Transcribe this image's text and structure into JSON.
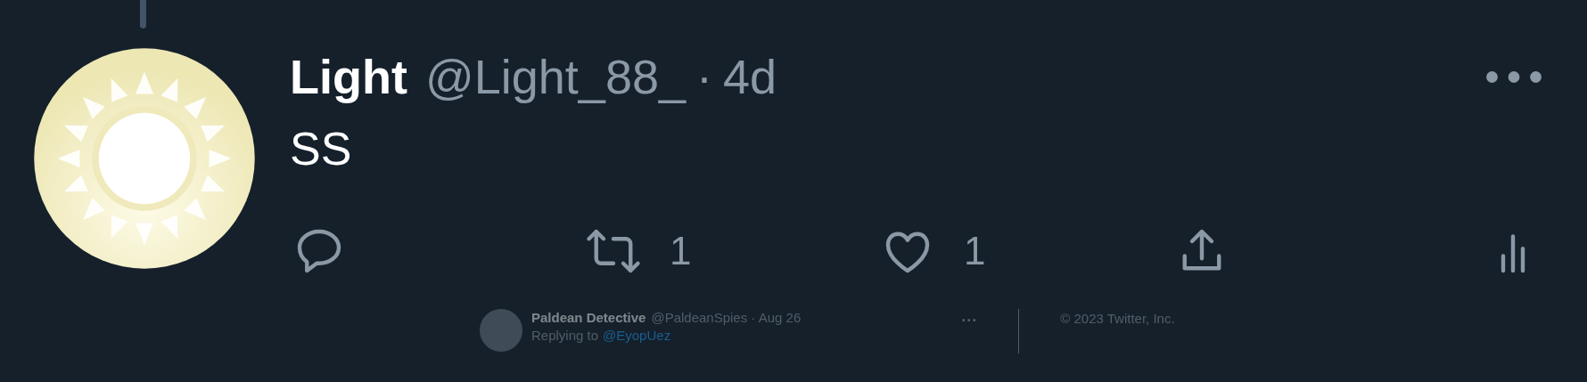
{
  "tweet": {
    "name": "Light",
    "handle": "@Light_88_",
    "separator": "·",
    "time": "4d",
    "text": "SS",
    "actions": [
      {
        "kind": "reply"
      },
      {
        "kind": "retweet",
        "count": "1"
      },
      {
        "kind": "like",
        "count": "1"
      },
      {
        "kind": "share"
      },
      {
        "kind": "views"
      }
    ]
  },
  "ghost": {
    "name": "Paldean Detective",
    "handle": "@PaldeanSpies · Aug 26",
    "replying": "Replying to",
    "reply_handle": "@EyopUez",
    "more": "···",
    "footer": "© 2023 Twitter, Inc."
  }
}
